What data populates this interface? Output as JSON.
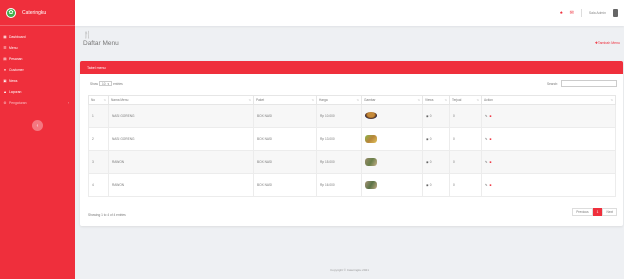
{
  "brand": {
    "name": "Cateringku",
    "logo_icon": "leaf-logo"
  },
  "sidebar": {
    "items": [
      {
        "icon": "dashboard-icon",
        "label": "Dashboard"
      },
      {
        "icon": "menu-icon",
        "label": "Menu"
      },
      {
        "icon": "pesanan-icon",
        "label": "Pesanan"
      },
      {
        "icon": "customer-icon",
        "label": "Customer"
      },
      {
        "icon": "news-icon",
        "label": "News"
      },
      {
        "icon": "laporan-icon",
        "label": "Laporan"
      }
    ],
    "collapsible": {
      "label": "Pengaturan",
      "chevron": "›"
    },
    "toggle_label": "‹"
  },
  "topbar": {
    "user_name": "Sala Admin"
  },
  "page": {
    "title": "Daftar Menu",
    "add_link": "Tambah Menu"
  },
  "card": {
    "header": "Tabel menu",
    "show_prefix": "Show",
    "show_value": "10",
    "show_suffix": "entries",
    "search_label": "Search:",
    "search_value": "",
    "columns": [
      "No",
      "Nama Menu",
      "Paket",
      "Harga",
      "Gambar",
      "Views",
      "Terjual",
      "Action"
    ],
    "rows": [
      {
        "no": "1",
        "nama": "NASI GORENG",
        "paket": "BOX NASI",
        "harga": "Rp 10.000",
        "views": "0",
        "terjual": "0"
      },
      {
        "no": "2",
        "nama": "NASI GORENG",
        "paket": "BOX NASI",
        "harga": "Rp 13.000",
        "views": "0",
        "terjual": "0"
      },
      {
        "no": "3",
        "nama": "RAWON",
        "paket": "BOX NASI",
        "harga": "Rp 15.000",
        "views": "0",
        "terjual": "0"
      },
      {
        "no": "4",
        "nama": "RAWON",
        "paket": "BOX NASI",
        "harga": "Rp 16.000",
        "views": "0",
        "terjual": "0"
      }
    ],
    "footer_info": "Showing 1 to 4 of 4 entries",
    "pager": {
      "prev": "Previous",
      "current": "1",
      "next": "Next"
    }
  },
  "copyright": "Copyright © Cateringku 2021"
}
